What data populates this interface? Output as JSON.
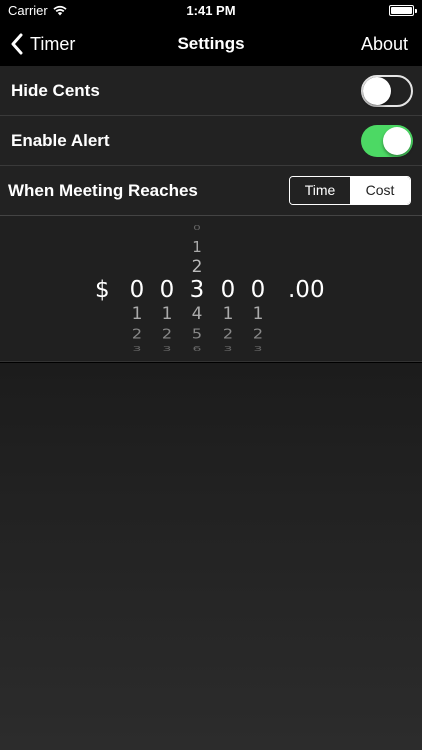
{
  "status_bar": {
    "carrier": "Carrier",
    "time": "1:41 PM"
  },
  "nav": {
    "back_label": "Timer",
    "title": "Settings",
    "right_label": "About"
  },
  "settings": {
    "hide_cents": {
      "label": "Hide Cents",
      "on": false
    },
    "enable_alert": {
      "label": "Enable Alert",
      "on": true
    },
    "meeting_reaches": {
      "label": "When Meeting Reaches",
      "options": [
        "Time",
        "Cost"
      ],
      "selected": "Cost"
    }
  },
  "picker": {
    "currency": "$",
    "cents": ".00",
    "columns": [
      {
        "sel": "0",
        "a1": "",
        "a2": "",
        "a3": "",
        "b1": "1",
        "b2": "2",
        "b3": "3"
      },
      {
        "sel": "0",
        "a1": "",
        "a2": "",
        "a3": "",
        "b1": "1",
        "b2": "2",
        "b3": "3"
      },
      {
        "sel": "3",
        "a1": "1",
        "a2": "2",
        "a3": "0",
        "b1": "4",
        "b2": "5",
        "b3": "6"
      },
      {
        "sel": "0",
        "a1": "",
        "a2": "",
        "a3": "",
        "b1": "1",
        "b2": "2",
        "b3": "3"
      },
      {
        "sel": "0",
        "a1": "",
        "a2": "",
        "a3": "",
        "b1": "1",
        "b2": "2",
        "b3": "3"
      }
    ]
  },
  "colors": {
    "switch_on": "#4cd964",
    "background": "#222222"
  },
  "icons": {
    "back": "chevron-left-icon",
    "wifi": "wifi-icon",
    "battery": "battery-icon"
  }
}
